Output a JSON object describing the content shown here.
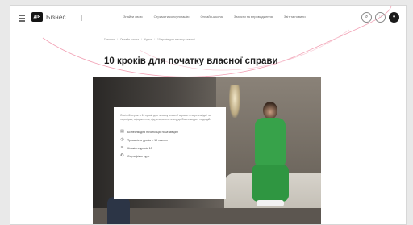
{
  "header": {
    "logo_mark": "ДІЯ",
    "logo_text": "Бізнес",
    "nav": [
      "Знайти свою",
      "Отримати консультацію",
      "Онлайн-школа",
      "Захисти та впровадження",
      "Звіт та новини"
    ],
    "icons": [
      "search-icon",
      "globe-icon",
      "user-icon"
    ]
  },
  "breadcrumb": [
    "Головна",
    "Онлайн-школа",
    "Курси",
    "10 кроків для початку власної..."
  ],
  "page": {
    "title": "10 кроків для початку власної справи"
  },
  "card": {
    "description": "Освітній серіал з 10 кроків для початку власної справи: створення ідеї та перевірка, оформлення, від резервного плану до бізнес-моделі та до дій.",
    "items": [
      {
        "icon": "book-icon",
        "label": "Бізнеснік для початківця, початківцям"
      },
      {
        "icon": "clock-icon",
        "label": "Тривалість уроків – 10 хвилин"
      },
      {
        "icon": "layers-icon",
        "label": "Кількість уроків 10"
      },
      {
        "icon": "certificate-icon",
        "label": "Сертифікат курс"
      }
    ]
  },
  "colors": {
    "accent_pink": "#f06a8c",
    "accent_green": "#37a24a"
  }
}
